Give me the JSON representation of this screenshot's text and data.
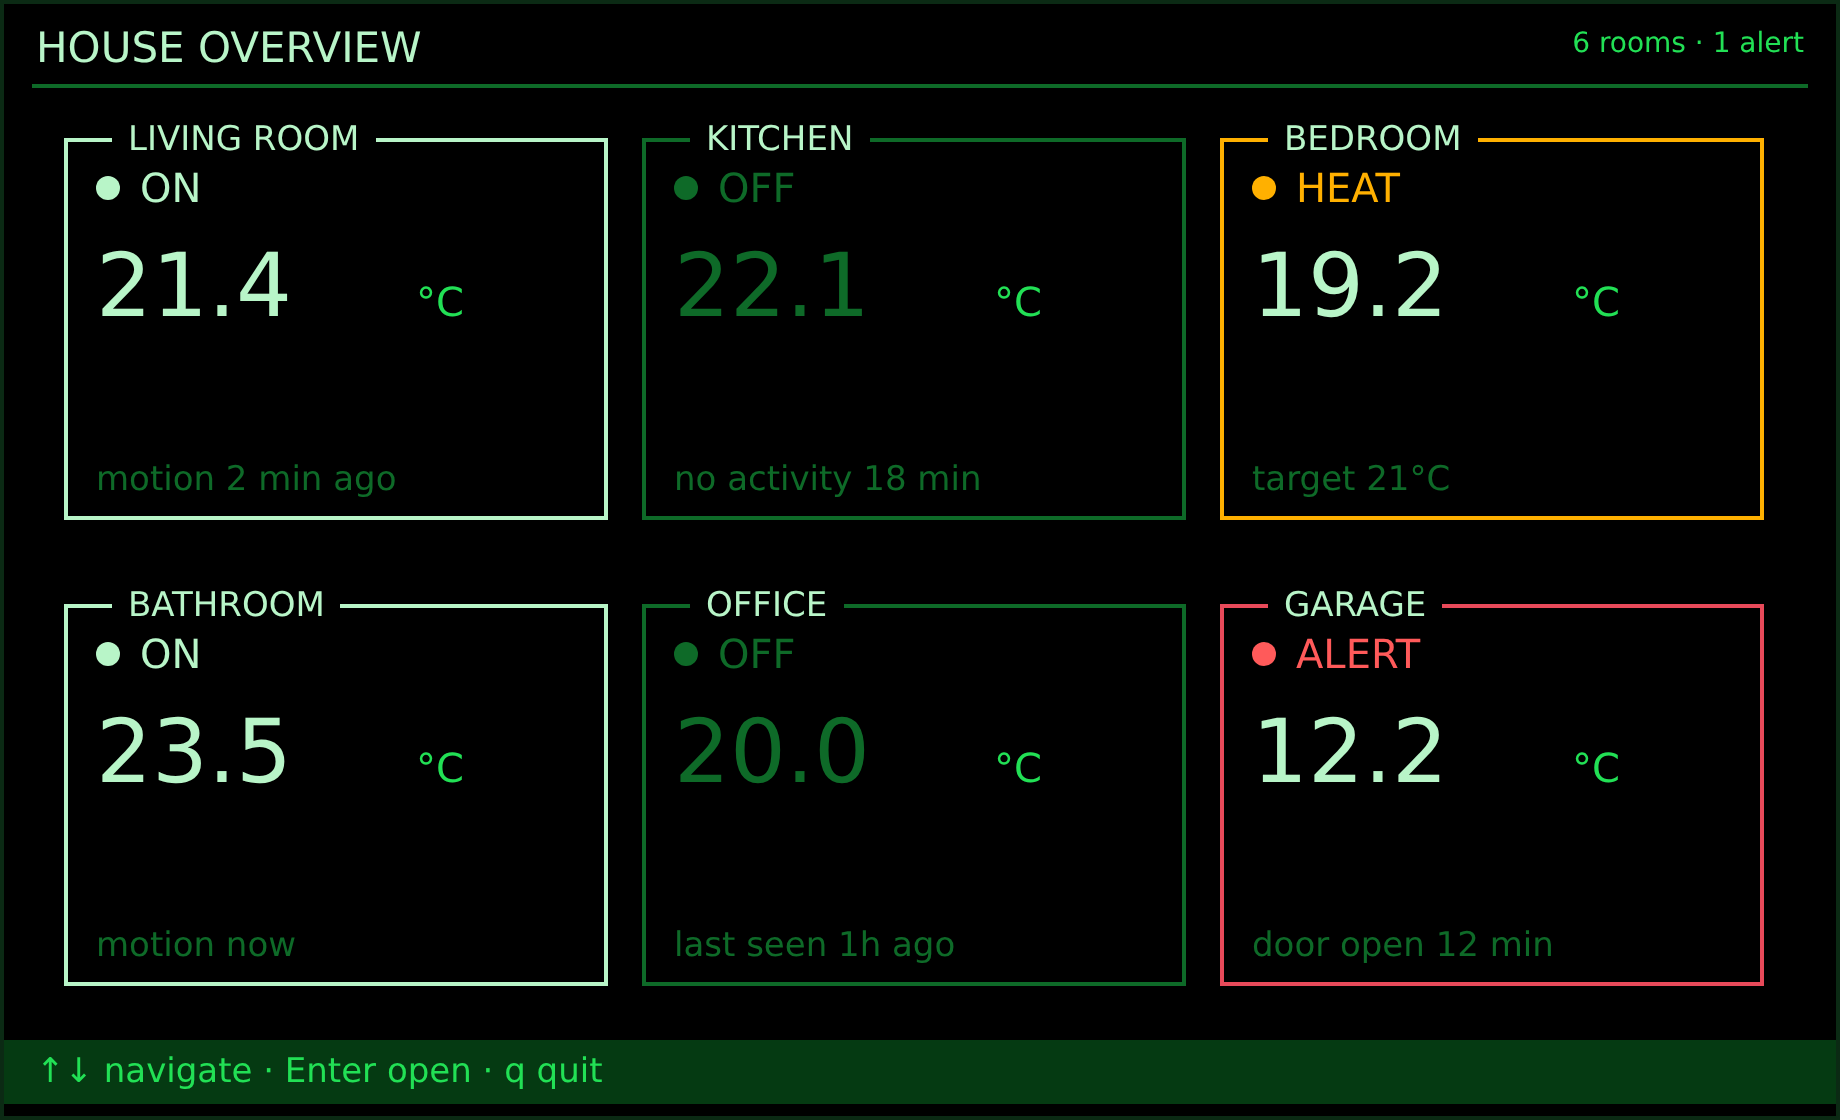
{
  "header": {
    "title": "HOUSE OVERVIEW",
    "summary": "6 rooms · 1 alert"
  },
  "rooms": [
    {
      "name": "LIVING ROOM",
      "kind": "on",
      "status": "ON",
      "temperature": "21.4",
      "unit": "°C",
      "note": "motion 2 min ago"
    },
    {
      "name": "KITCHEN",
      "kind": "off",
      "status": "OFF",
      "temperature": "22.1",
      "unit": "°C",
      "note": "no activity 18 min"
    },
    {
      "name": "BEDROOM",
      "kind": "heat",
      "status": "HEAT",
      "temperature": "19.2",
      "unit": "°C",
      "note": "target 21°C"
    },
    {
      "name": "BATHROOM",
      "kind": "on",
      "status": "ON",
      "temperature": "23.5",
      "unit": "°C",
      "note": "motion now"
    },
    {
      "name": "OFFICE",
      "kind": "off",
      "status": "OFF",
      "temperature": "20.0",
      "unit": "°C",
      "note": "last seen 1h ago"
    },
    {
      "name": "GARAGE",
      "kind": "alert",
      "status": "ALERT",
      "temperature": "12.2",
      "unit": "°C",
      "note": "door open 12 min"
    }
  ],
  "status_bar": "↑↓ navigate · Enter open · q quit"
}
